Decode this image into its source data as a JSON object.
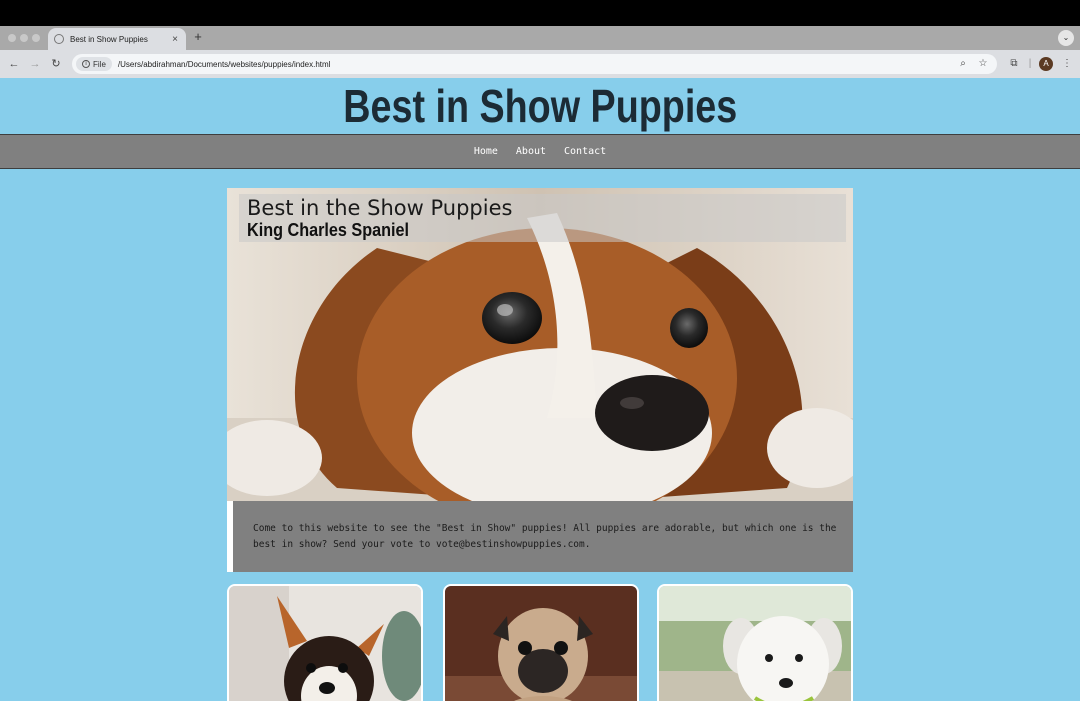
{
  "browser": {
    "tab_title": "Best in Show Puppies",
    "new_tab": "+",
    "close": "×",
    "file_label": "File",
    "url": "/Users/abdirahman/Documents/websites/puppies/index.html",
    "avatar_letter": "A"
  },
  "site": {
    "title": "Best in Show Puppies",
    "nav": [
      "Home",
      "About",
      "Contact"
    ]
  },
  "hero": {
    "title": "Best in the Show Puppies",
    "subtitle": "King Charles Spaniel"
  },
  "intro": {
    "text": "Come to this website to see the \"Best in Show\" puppies! All puppies are adorable, but which one is the best in show? Send your vote to vote@bestinshowpuppies.com."
  },
  "cards": [
    {
      "breed": "corgi"
    },
    {
      "breed": "pug"
    },
    {
      "breed": "white-puppy"
    }
  ],
  "colors": {
    "page_bg": "#87ceeb",
    "nav_bg": "#808080",
    "title": "#1c2b35"
  }
}
